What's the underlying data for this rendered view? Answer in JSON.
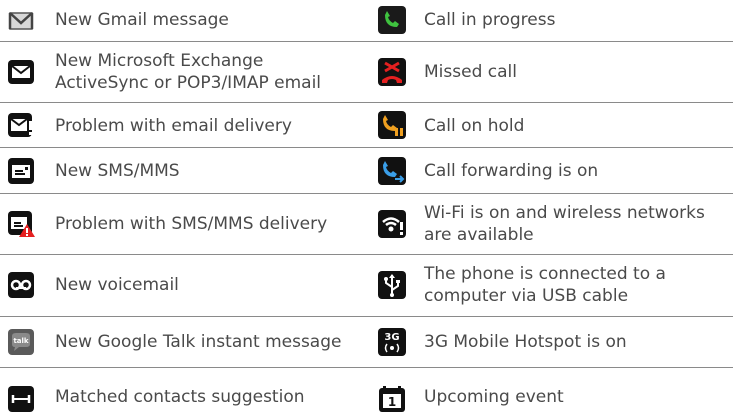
{
  "rows": [
    {
      "left": {
        "icon": "gmail-icon",
        "text": "New Gmail message"
      },
      "right": {
        "icon": "call-in-progress-icon",
        "text": "Call in progress"
      }
    },
    {
      "left": {
        "icon": "email-icon",
        "text1": "New Microsoft Exchange",
        "text2": "ActiveSync or POP3/IMAP email"
      },
      "right": {
        "icon": "missed-call-icon",
        "text": "Missed call"
      }
    },
    {
      "left": {
        "icon": "email-problem-icon",
        "text": "Problem with email delivery"
      },
      "right": {
        "icon": "call-on-hold-icon",
        "text": "Call on hold"
      }
    },
    {
      "left": {
        "icon": "sms-icon",
        "text": "New SMS/MMS"
      },
      "right": {
        "icon": "call-forwarding-icon",
        "text": "Call forwarding is on"
      }
    },
    {
      "left": {
        "icon": "sms-problem-icon",
        "text": "Problem with SMS/MMS delivery"
      },
      "right": {
        "icon": "wifi-icon",
        "text1": "Wi-Fi is on and wireless networks",
        "text2": "are available"
      }
    },
    {
      "left": {
        "icon": "voicemail-icon",
        "text": "New voicemail"
      },
      "right": {
        "icon": "usb-icon",
        "text1": "The phone is connected to a",
        "text2": "computer via USB cable"
      }
    },
    {
      "left": {
        "icon": "google-talk-icon",
        "text": "New Google Talk instant message"
      },
      "right": {
        "icon": "hotspot-3g-icon",
        "text": "3G Mobile Hotspot is on",
        "badge": "3G"
      }
    },
    {
      "left": {
        "icon": "matched-contacts-icon",
        "text": "Matched contacts suggestion"
      },
      "right": {
        "icon": "calendar-icon",
        "text": "Upcoming event",
        "badge": "1"
      }
    }
  ],
  "talk_badge": "talk"
}
